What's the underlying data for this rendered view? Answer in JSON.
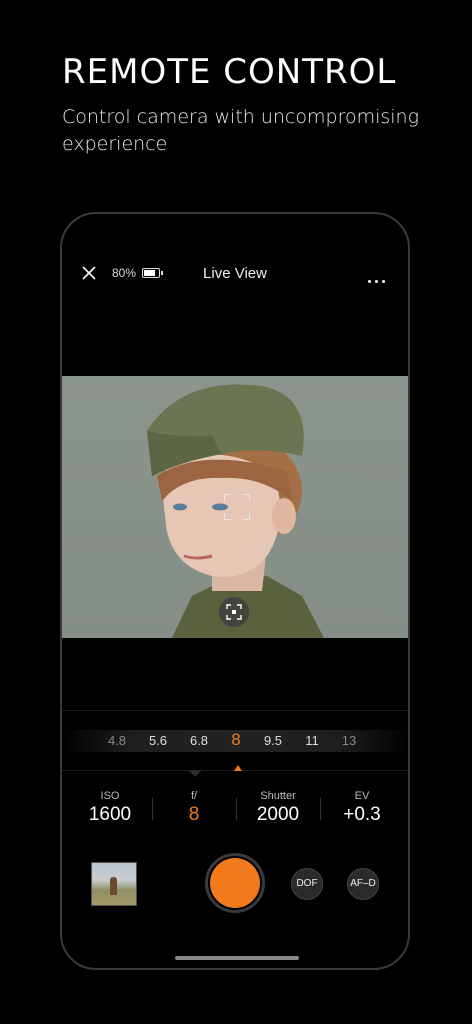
{
  "promo": {
    "headline": "REMOTE CONTROL",
    "subline": "Control camera with uncompromising experience"
  },
  "topbar": {
    "close_icon": "close-icon",
    "battery_text": "80%",
    "battery_level": 0.8,
    "title": "Live View",
    "more_icon": "more-icon"
  },
  "aperture": {
    "values": [
      "4.8",
      "5.6",
      "6.8",
      "8",
      "9.5",
      "11",
      "13"
    ],
    "selected": "8"
  },
  "params": {
    "iso": {
      "label": "ISO",
      "value": "1600"
    },
    "fstop": {
      "label": "f/",
      "value": "8"
    },
    "shutter": {
      "label": "Shutter",
      "value": "2000"
    },
    "ev": {
      "label": "EV",
      "value": "+0.3"
    }
  },
  "controls": {
    "dof_label": "DOF",
    "af_label": "AF–D"
  },
  "colors": {
    "accent": "#f07a1c",
    "background": "#000000"
  }
}
